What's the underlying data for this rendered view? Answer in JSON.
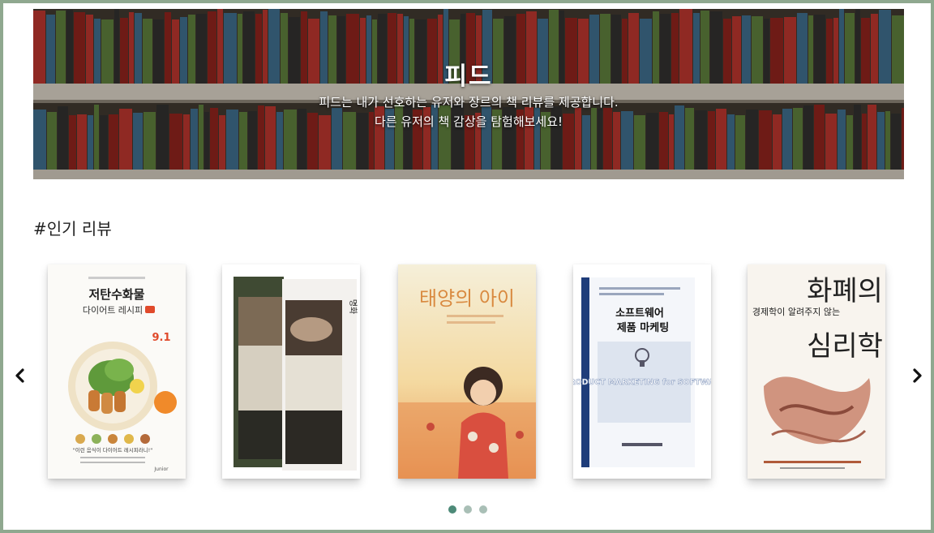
{
  "hero": {
    "title": "피드",
    "subtitle_line1": "피드는 내가 선호하는 유저와 장르의 책 리뷰를 제공합니다.",
    "subtitle_line2": "다른 유저의 책 감상을 탐험해보세요!"
  },
  "section": {
    "title": "#인기 리뷰"
  },
  "carousel": {
    "prev_icon": "chevron-left-icon",
    "next_icon": "chevron-right-icon",
    "pages": 3,
    "active_page": 1,
    "books": [
      {
        "cover_top": "저탄수화물",
        "cover_sub": "다이어트 레시피",
        "cover_badge": "9.1",
        "cover_foot": "\"이런 음식이 다이어트 레시피라니!\"",
        "publisher": "Junior"
      },
      {
        "cover_top": "명화"
      },
      {
        "cover_top": "태양의 아이"
      },
      {
        "cover_top": "소프트웨어",
        "cover_sub": "제품 마케팅",
        "cover_en": "PRODUCT MARKETING for SOFTWARE"
      },
      {
        "cover_top": "화폐의",
        "cover_sub": "심리학",
        "cover_small": "경제학이 알려주지 않는"
      }
    ]
  }
}
